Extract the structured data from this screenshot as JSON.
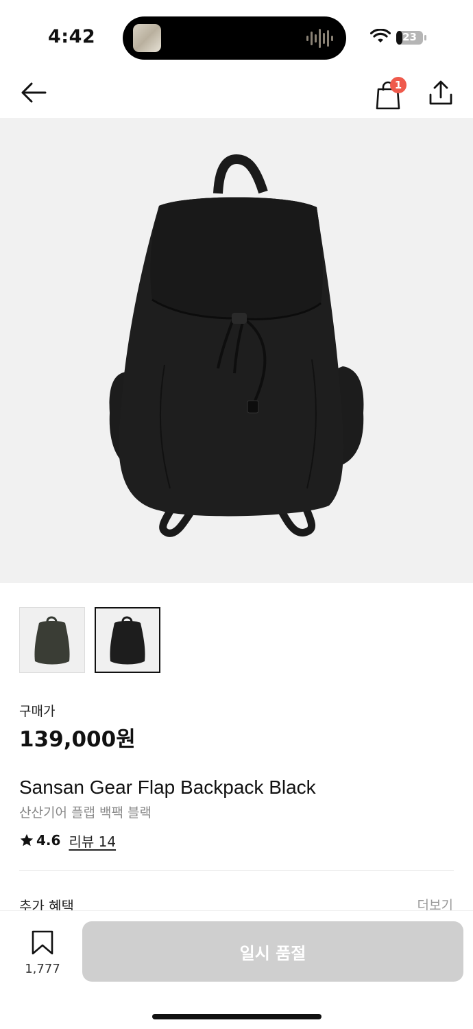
{
  "status_bar": {
    "time": "4:42",
    "battery": "23"
  },
  "header": {
    "back_icon": "arrow-left-icon",
    "cart_icon": "shopping-bag-icon",
    "cart_badge": "1",
    "share_icon": "share-icon",
    "badge_color": "#ef5a4c"
  },
  "product": {
    "price_label": "구매가",
    "price": "139,000원",
    "name": "Sansan Gear Flap Backpack Black",
    "name_sub": "산산기어 플랩 백팩 블랙",
    "rating": "4.6",
    "review_link": "리뷰 14",
    "thumbnails": [
      "olive backpack",
      "black backpack"
    ]
  },
  "benefits": {
    "label": "추가 혜택",
    "more": "더보기"
  },
  "bottom_bar": {
    "bookmark_count": "1,777",
    "cta_label": "일시 품절"
  }
}
